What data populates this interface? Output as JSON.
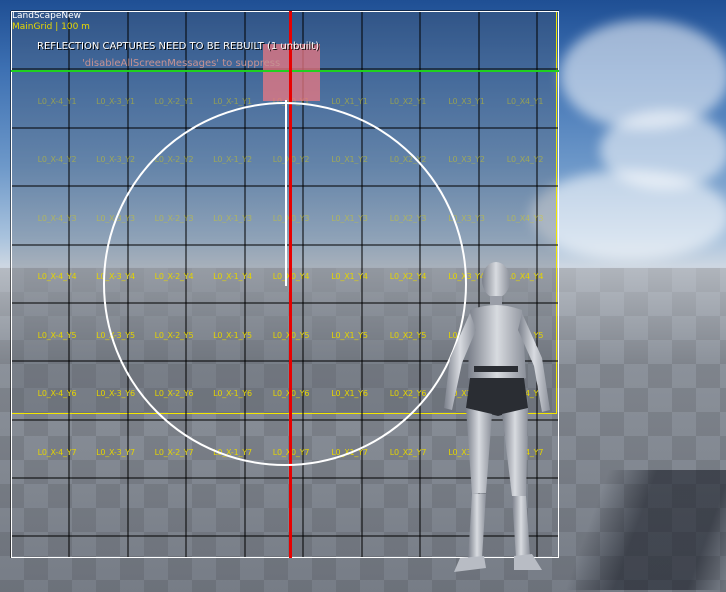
{
  "viewport": {
    "landscape_name": "LandScapeNew",
    "grid_info": "MainGrid | 100 m",
    "messages": {
      "warning": "REFLECTION CAPTURES NEED TO BE REBUILT (1 unbuilt)",
      "suppress_hint": "'disableAllScreenMessages' to suppress"
    },
    "colors": {
      "landscape_bounds": "#f2e600",
      "cell_label": "#e4d400",
      "axis": "#e80000",
      "streaming_line": "#1fd01f",
      "highlight_cell": "#eb7882"
    }
  },
  "cell_rows": [
    [
      "",
      "",
      "",
      "",
      "",
      "",
      "",
      "",
      ""
    ],
    [
      "L0_X-4_Y1",
      "L0_X-3_Y1",
      "L0_X-2_Y1",
      "L0_X-1_Y1",
      "L0_X0_Y1",
      "L0_X1_Y1",
      "L0_X2_Y1",
      "L0_X3_Y1",
      "L0_X4_Y1"
    ],
    [
      "L0_X-4_Y2",
      "L0_X-3_Y2",
      "L0_X-2_Y2",
      "L0_X-1_Y2",
      "L0_X0_Y2",
      "L0_X1_Y2",
      "L0_X2_Y2",
      "L0_X3_Y2",
      "L0_X4_Y2"
    ],
    [
      "L0_X-4_Y3",
      "L0_X-3_Y3",
      "L0_X-2_Y3",
      "L0_X-1_Y3",
      "L0_X0_Y3",
      "L0_X1_Y3",
      "L0_X2_Y3",
      "L0_X3_Y3",
      "L0_X4_Y3"
    ],
    [
      "L0_X-4_Y4",
      "L0_X-3_Y4",
      "L0_X-2_Y4",
      "L0_X-1_Y4",
      "L0_X0_Y4",
      "L0_X1_Y4",
      "L0_X2_Y4",
      "L0_X3_Y4",
      "L0_X4_Y4"
    ],
    [
      "L0_X-4_Y5",
      "L0_X-3_Y5",
      "L0_X-2_Y5",
      "L0_X-1_Y5",
      "L0_X0_Y5",
      "L0_X1_Y5",
      "L0_X2_Y5",
      "L0_X3_Y5",
      "L0_X4_Y5"
    ],
    [
      "L0_X-4_Y6",
      "L0_X-3_Y6",
      "L0_X-2_Y6",
      "L0_X-1_Y6",
      "L0_X0_Y6",
      "L0_X1_Y6",
      "L0_X2_Y6",
      "L0_X3_Y6",
      "L0_X4_Y6"
    ],
    [
      "L0_X-4_Y7",
      "L0_X-3_Y7",
      "L0_X-2_Y7",
      "L0_X-1_Y7",
      "L0_X0_Y7",
      "L0_X1_Y7",
      "L0_X2_Y7",
      "L0_X3_Y7",
      "L0_X4_Y7"
    ],
    [
      "",
      "",
      "",
      "",
      "",
      "",
      "",
      "",
      ""
    ]
  ]
}
